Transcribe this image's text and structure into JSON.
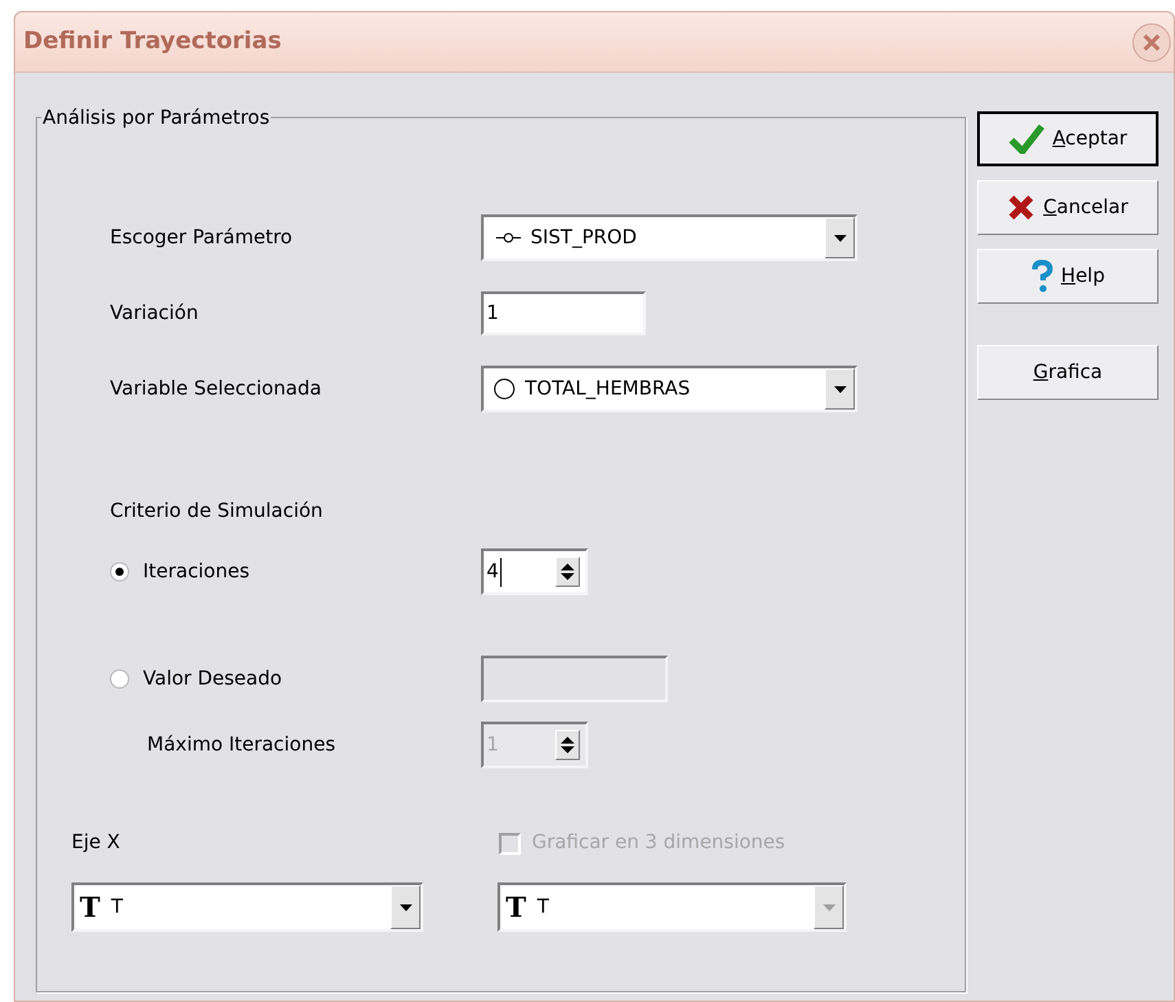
{
  "window": {
    "title": "Definir Trayectorias"
  },
  "group": {
    "title": "Análisis por Parámetros",
    "parameter": {
      "label": "Escoger Parámetro",
      "value": "SIST_PROD"
    },
    "variation": {
      "label": "Variación",
      "value": "1"
    },
    "variable": {
      "label": "Variable Seleccionada",
      "value": "TOTAL_HEMBRAS"
    },
    "criterion": {
      "label": "Criterio de Simulación",
      "options": [
        {
          "label": "Iteraciones",
          "selected": true,
          "value": "4"
        },
        {
          "label": "Valor Deseado",
          "selected": false
        }
      ],
      "max_iterations": {
        "label": "Máximo Iteraciones",
        "value": "1",
        "disabled": true
      }
    },
    "x_axis": {
      "label": "Eje X",
      "icon_char": "T",
      "value": "T",
      "disabled": false
    },
    "three_d": {
      "label": "Graficar en 3 dimensiones",
      "checked": false,
      "disabled": true
    },
    "z_axis": {
      "icon_char": "T",
      "value": "T",
      "disabled": true
    }
  },
  "buttons": [
    {
      "kind": "ok",
      "label": "Aceptar"
    },
    {
      "kind": "cancel",
      "label": "Cancelar"
    },
    {
      "kind": "help",
      "label": "Help"
    },
    {
      "kind": "plain",
      "label": "Grafica"
    }
  ]
}
